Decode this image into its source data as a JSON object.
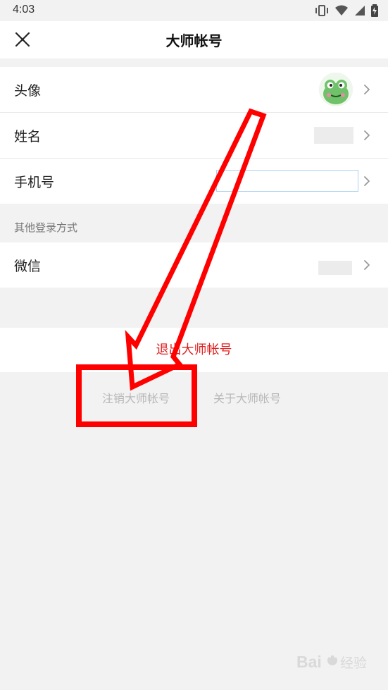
{
  "status_bar": {
    "time": "4:03"
  },
  "header": {
    "title": "大师帐号",
    "close_icon": "close-icon"
  },
  "profile": {
    "avatar": {
      "label": "头像",
      "value_type": "avatar"
    },
    "name": {
      "label": "姓名"
    },
    "phone": {
      "label": "手机号"
    }
  },
  "other_login": {
    "label": "其他登录方式",
    "wechat": {
      "label": "微信"
    }
  },
  "actions": {
    "logout": "退出大师帐号",
    "cancel_account": "注销大师帐号",
    "about": "关于大师帐号"
  },
  "annotation": {
    "arrow_color": "#ff0000",
    "box_color": "#ff0000"
  },
  "watermark": {
    "text": "Baidu 经验"
  }
}
